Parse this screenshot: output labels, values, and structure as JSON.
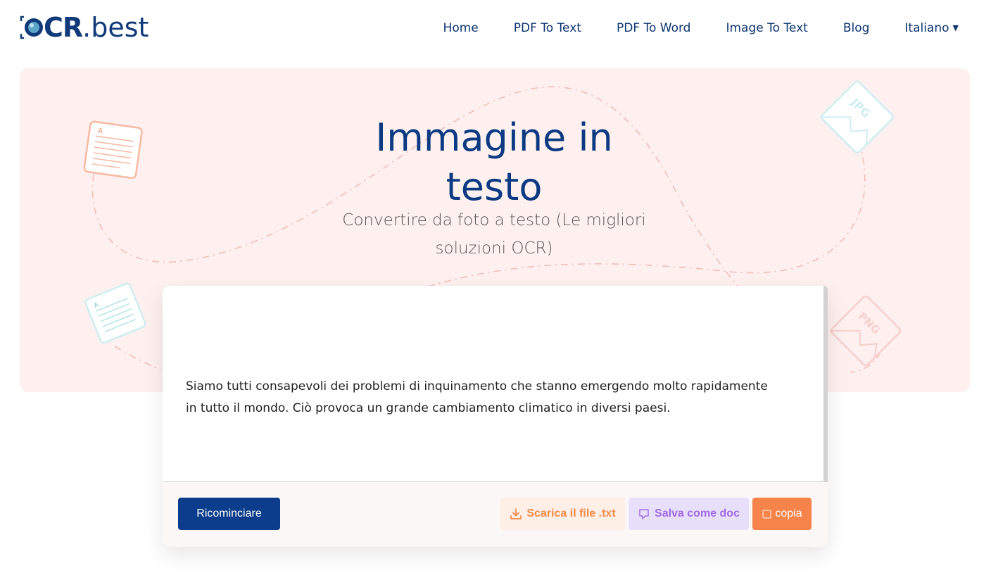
{
  "header": {
    "logo": {
      "ocr": "CR",
      "best": ".best"
    },
    "nav": [
      {
        "label": "Home"
      },
      {
        "label": "PDF To Text"
      },
      {
        "label": "PDF To Word"
      },
      {
        "label": "Image To Text"
      },
      {
        "label": "Blog"
      },
      {
        "label": "Italiano"
      }
    ]
  },
  "hero": {
    "title_line1": "Immagine in",
    "title_line2": "testo",
    "subtitle_line1": "Convertire da foto a testo (Le migliori",
    "subtitle_line2": "soluzioni OCR)",
    "deco_labels": {
      "jpg": "JPG",
      "png": "PNG",
      "doc": "A"
    }
  },
  "result": {
    "line1": "Siamo tutti consapevoli dei problemi di inquinamento che stanno emergendo molto rapidamente",
    "line2": "in tutto il mondo. Ciò provoca un grande cambiamento climatico in diversi paesi."
  },
  "actions": {
    "restart": "Ricominciare",
    "download": "Scarica il file .txt",
    "save_doc": "Salva come doc",
    "copy": "copia"
  },
  "colors": {
    "brand_blue": "#0b3d8c",
    "hero_bg": "#fdf0ef",
    "download_fg": "#f28a4a",
    "doc_fg": "#a06ae6",
    "copy_bg": "#f5834a"
  },
  "icons": {
    "download": "download-icon",
    "save_doc": "document-icon",
    "copy": "copy-icon",
    "language": "caret-down-icon"
  }
}
